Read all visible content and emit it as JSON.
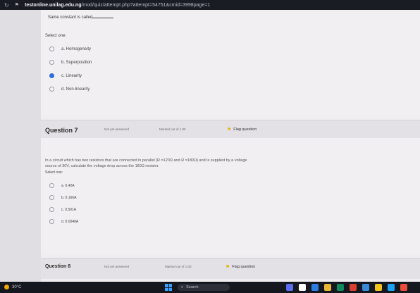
{
  "browser": {
    "host": "testonline.unilag.edu.ng",
    "path": "/mod/quiz/attempt.php?attempt=54751&cmid=3998page=1"
  },
  "q6": {
    "caption": "Same constant is called",
    "select_one": "Select one:",
    "options": [
      {
        "label": "a. Homogeneity",
        "checked": false
      },
      {
        "label": "b. Superposition",
        "checked": false
      },
      {
        "label": "c. Linearity",
        "checked": true
      },
      {
        "label": "d. Non-linearity",
        "checked": false
      }
    ]
  },
  "q7": {
    "title": "Question 7",
    "status": "Not yet answered",
    "marks": "Marked out of 1.00",
    "flag": "Flag question",
    "text_line1": "In a circuit which has two resistors that are connected in parallel (R  =120Ω and R  =180Ω) and is supplied by a voltage",
    "text_line2": "source of 30V, calculate the voltage drop across the 180Ω resistor.",
    "select_one": "Select one:",
    "options": [
      {
        "label": "a. 0.42A"
      },
      {
        "label": "b. 0.166A"
      },
      {
        "label": "c. 0.501A"
      },
      {
        "label": "d. 0.0048A"
      }
    ]
  },
  "q8": {
    "title": "Question 8",
    "status": "Not yet answered",
    "marks": "Marked out of 1.00",
    "flag": "Flag question"
  },
  "taskbar": {
    "weather": "30°C",
    "search": "Search"
  }
}
